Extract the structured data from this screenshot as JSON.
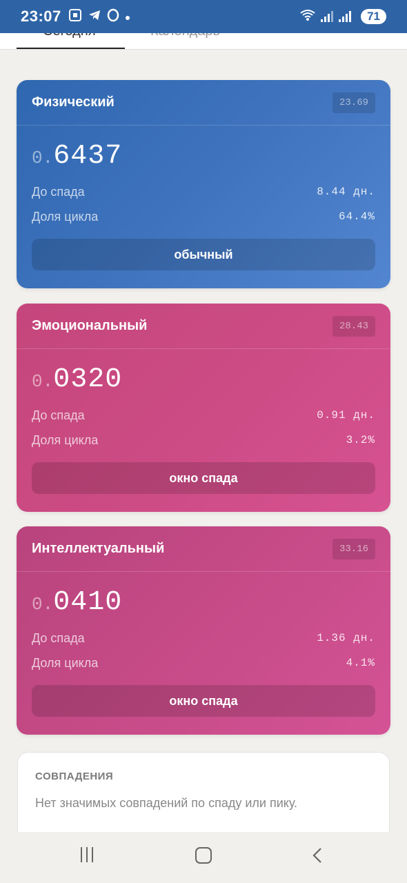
{
  "status_bar": {
    "time": "23:07",
    "battery": "71",
    "icons": [
      "screenshot-icon",
      "telegram-icon",
      "opera-icon",
      "dot-icon",
      "wifi-icon",
      "signal-icon",
      "signal-icon"
    ]
  },
  "tabs": [
    {
      "label": "Сегодня",
      "active": true
    },
    {
      "label": "Календарь",
      "active": false
    }
  ],
  "cards": {
    "physical": {
      "title": "Физический",
      "chip": "23.69",
      "value_prefix": "0.",
      "value_main": "6437",
      "rows": [
        {
          "label": "До спада",
          "value": "8.44 дн."
        },
        {
          "label": "Доля цикла",
          "value": "64.4%"
        }
      ],
      "state": "обычный",
      "color": "#3f73bd"
    },
    "emotional": {
      "title": "Эмоциональный",
      "chip": "28.43",
      "value_prefix": "0.",
      "value_main": "0320",
      "rows": [
        {
          "label": "До спада",
          "value": "0.91 дн."
        },
        {
          "label": "Доля цикла",
          "value": "3.2%"
        }
      ],
      "state": "окно спада",
      "color": "#cc4b84"
    },
    "intellectual": {
      "title": "Интеллектуальный",
      "chip": "33.16",
      "value_prefix": "0.",
      "value_main": "0410",
      "rows": [
        {
          "label": "До спада",
          "value": "1.36 дн."
        },
        {
          "label": "Доля цикла",
          "value": "4.1%"
        }
      ],
      "state": "окно спада",
      "color": "#c64b87"
    }
  },
  "matches": {
    "title": "СОВПАДЕНИЯ",
    "text": "Нет значимых совпадений по спаду или пику."
  }
}
